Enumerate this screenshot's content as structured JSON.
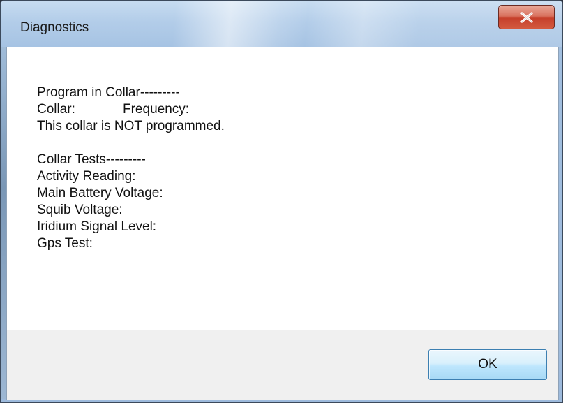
{
  "window": {
    "title": "Diagnostics",
    "close_icon": "close-icon"
  },
  "program": {
    "heading": "Program in Collar---------",
    "collar_label": "Collar:",
    "frequency_label": "Frequency:",
    "status": "This collar is NOT programmed."
  },
  "tests": {
    "heading": "Collar Tests---------",
    "activity_reading": "Activity Reading:",
    "main_battery_voltage": "Main Battery Voltage:",
    "squib_voltage": "Squib Voltage:",
    "iridium_signal_level": "Iridium Signal Level:",
    "gps_test": "Gps Test:"
  },
  "buttons": {
    "ok_label": "OK"
  },
  "colors": {
    "close_button": "#c6402b",
    "ok_button_border": "#3c7fb1"
  }
}
